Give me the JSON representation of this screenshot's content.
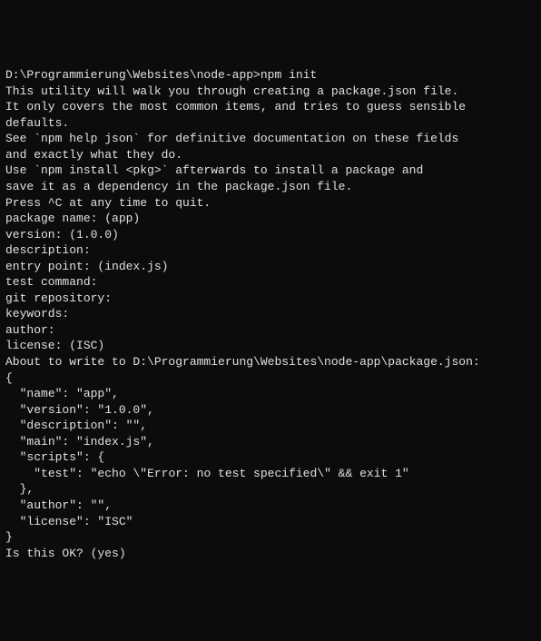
{
  "terminal": {
    "prompt": "D:\\Programmierung\\Websites\\node-app>",
    "command": "npm init",
    "output": {
      "intro1": "This utility will walk you through creating a package.json file.",
      "intro2": "It only covers the most common items, and tries to guess sensible defaults.",
      "blank1": "",
      "see1": "See `npm help json` for definitive documentation on these fields",
      "see2": "and exactly what they do.",
      "blank2": "",
      "use1": "Use `npm install <pkg>` afterwards to install a package and",
      "use2": "save it as a dependency in the package.json file.",
      "blank3": "",
      "press": "Press ^C at any time to quit.",
      "pkg_name": "package name: (app)",
      "version": "version: (1.0.0)",
      "description": "description:",
      "entry": "entry point: (index.js)",
      "test": "test command:",
      "git": "git repository:",
      "keywords": "keywords:",
      "author": "author:",
      "license": "license: (ISC)",
      "about": "About to write to D:\\Programmierung\\Websites\\node-app\\package.json:",
      "blank4": "",
      "json_open": "{",
      "json_name": "  \"name\": \"app\",",
      "json_version": "  \"version\": \"1.0.0\",",
      "json_desc": "  \"description\": \"\",",
      "json_main": "  \"main\": \"index.js\",",
      "json_scripts": "  \"scripts\": {",
      "json_test": "    \"test\": \"echo \\\"Error: no test specified\\\" && exit 1\"",
      "json_scripts_close": "  },",
      "json_author": "  \"author\": \"\",",
      "json_license": "  \"license\": \"ISC\"",
      "json_close": "}",
      "blank5": "",
      "blank6": "",
      "is_ok": "Is this OK? (yes)"
    }
  }
}
